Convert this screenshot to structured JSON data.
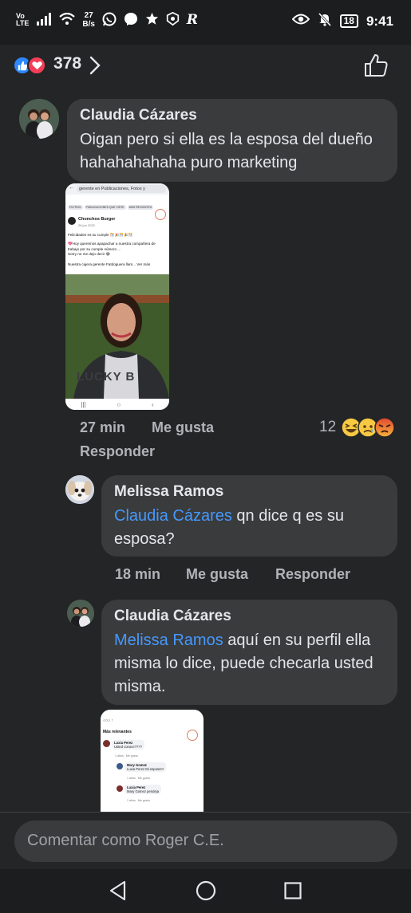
{
  "status_bar": {
    "volte": "Vo\nLTE",
    "speed_value": "27",
    "speed_unit": "B/s",
    "battery": "18",
    "time": "9:41"
  },
  "post": {
    "reaction_count": "378",
    "reaction_icons": [
      "like-icon",
      "love-icon"
    ]
  },
  "comments": [
    {
      "author": "Claudia Cázares",
      "text": "Oigan pero si ella es la esposa del dueño hahahahahaha puro marketing",
      "time": "27 min",
      "like_label": "Me gusta",
      "reply_label": "Responder",
      "reaction_count": "12",
      "reaction_icons": [
        "haha-icon",
        "sad-icon",
        "angry-icon"
      ],
      "attachment": {
        "search_text": "gerente en Publicaciones, Fotos y",
        "chips": [
          "FILTROS",
          "PUBLICACIONES QUE VISTE",
          "MÁS RECIENTES"
        ],
        "page_name": "Chonchos Burger",
        "page_date": "26 jun 2022",
        "lines": [
          "Felicidades es su cumple 🎊🎉🎊🎉🎊",
          "💖Hoy queremos apapachar a nuestra compañera de trabajo por su cumple número ...",
          "Sorry no me dejo decir 😂",
          "Nuestra cajera gerente Fatdoguera llam... Ver más"
        ],
        "shirt_text": "LUCKY B"
      }
    },
    {
      "author": "Melissa Ramos",
      "mention": "Claudia Cázares",
      "text": " qn dice q es su esposa?",
      "time": "18 min",
      "like_label": "Me gusta",
      "reply_label": "Responder"
    },
    {
      "author": "Claudia Cázares",
      "mention": "Melissa Ramos",
      "text": " aquí en su perfil ella misma lo dice, puede checarla usted misma.",
      "attachment": {
        "header": "Más relevantes",
        "items": [
          {
            "name": "Luxia Perez",
            "text": "Usted conoce????",
            "meta": "1 años   Me gusta"
          },
          {
            "name": "Mary Gomez",
            "text": "Luxia Perez Mi esposo!!!",
            "meta": "1 años   Me gusta"
          },
          {
            "name": "Luxia Perez",
            "text": "Mary Gomez pendeja",
            "meta": "1 años   Me gusta"
          }
        ]
      }
    }
  ],
  "composer": {
    "placeholder": "Comentar como Roger C.E."
  },
  "colors": {
    "background": "#242526",
    "bubble": "#3a3b3c",
    "mention": "#4599ff",
    "meta_text": "#b0b3b8",
    "like_blue": "#2d88ff",
    "love_red": "#f33e58"
  }
}
